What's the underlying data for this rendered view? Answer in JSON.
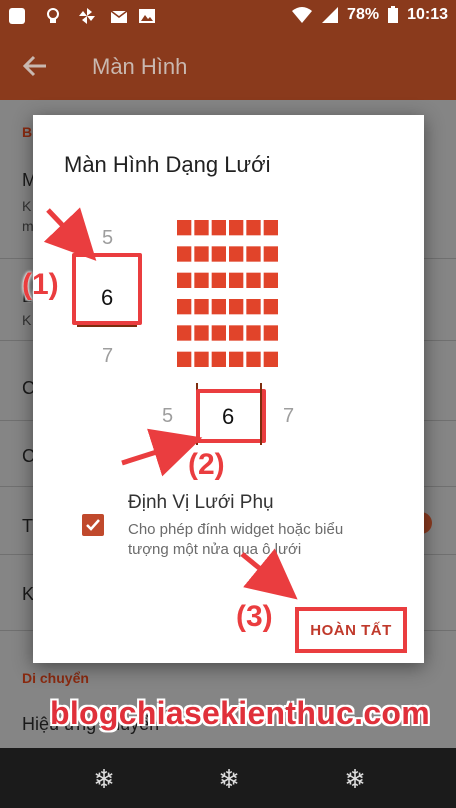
{
  "status_bar": {
    "battery": "78%",
    "time": "10:13"
  },
  "app_bar": {
    "title": "Màn Hình"
  },
  "background": {
    "section_top": "B",
    "rows": [
      "M",
      "K",
      "m",
      "L",
      "K",
      "C",
      "C",
      "T",
      "K"
    ],
    "section_bottom": "Di chuyển",
    "bottom_row": "Hiệu ứng chuyển"
  },
  "dialog": {
    "title": "Màn Hình Dạng Lưới",
    "rows_picker": {
      "above": "5",
      "selected": "6",
      "below": "7"
    },
    "cols_picker": {
      "left": "5",
      "selected": "6",
      "right": "7"
    },
    "grid": {
      "rows": 6,
      "columns": 6,
      "color": "#e1442a"
    },
    "option": {
      "checked": true,
      "title": "Định Vị Lưới Phụ",
      "description": "Cho phép đính widget hoặc biểu tượng một nửa qua ô lưới"
    },
    "done_label": "HOÀN TẤT"
  },
  "annotations": {
    "step1": "(1)",
    "step2": "(2)",
    "step3": "(3)",
    "accent_color": "#ea3d3f"
  },
  "watermark": "blogchiasekienthuc.com",
  "nav_bar": {
    "icons": [
      "snowflake-icon",
      "snowflake-icon",
      "snowflake-icon"
    ]
  }
}
